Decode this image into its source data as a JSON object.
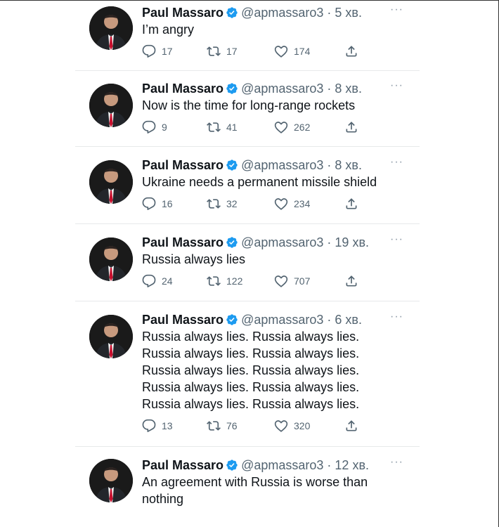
{
  "colors": {
    "verified": "#1d9bf0",
    "text": "#0f1419",
    "secondary": "#536471"
  },
  "tweets": [
    {
      "author": "Paul Massaro",
      "handle": "@apmassaro3",
      "separator": "·",
      "time": "5 хв.",
      "text": "I’m angry",
      "replies": "17",
      "retweets": "17",
      "likes": "174",
      "more": "···"
    },
    {
      "author": "Paul Massaro",
      "handle": "@apmassaro3",
      "separator": "·",
      "time": "8 хв.",
      "text": "Now is the time for long-range rockets",
      "replies": "9",
      "retweets": "41",
      "likes": "262",
      "more": "···"
    },
    {
      "author": "Paul Massaro",
      "handle": "@apmassaro3",
      "separator": "·",
      "time": "8 хв.",
      "text": "Ukraine needs a permanent missile shield",
      "replies": "16",
      "retweets": "32",
      "likes": "234",
      "more": "···"
    },
    {
      "author": "Paul Massaro",
      "handle": "@apmassaro3",
      "separator": "·",
      "time": "19 хв.",
      "text": "Russia always lies",
      "replies": "24",
      "retweets": "122",
      "likes": "707",
      "more": "···"
    },
    {
      "author": "Paul Massaro",
      "handle": "@apmassaro3",
      "separator": "·",
      "time": "6 хв.",
      "text": "Russia always lies. Russia always lies. Russia always lies. Russia always lies. Russia always lies. Russia always lies. Russia always lies. Russia always lies. Russia always lies. Russia always lies.",
      "replies": "13",
      "retweets": "76",
      "likes": "320",
      "more": "···"
    },
    {
      "author": "Paul Massaro",
      "handle": "@apmassaro3",
      "separator": "·",
      "time": "12 хв.",
      "text": "An agreement with Russia is worse than nothing",
      "more": "···"
    }
  ]
}
